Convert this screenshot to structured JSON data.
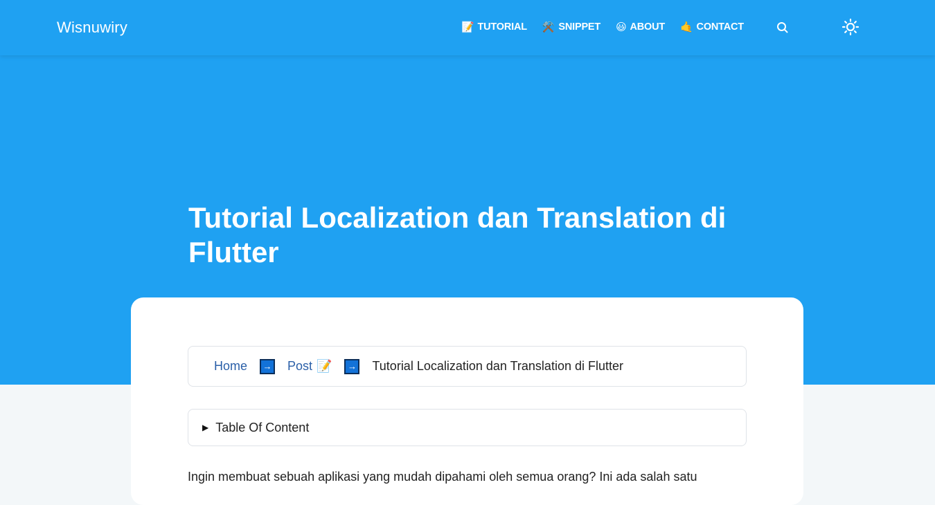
{
  "header": {
    "brand": "Wisnuwiry",
    "nav": [
      {
        "emoji": "📝",
        "label": "TUTORIAL"
      },
      {
        "emoji": "⚒️",
        "label": "SNIPPET"
      },
      {
        "emoji": "😃",
        "label": "ABOUT"
      },
      {
        "emoji": "🤙",
        "label": "CONTACT"
      }
    ],
    "search_icon": "search-icon",
    "theme_icon": "sun-icon"
  },
  "hero": {
    "title": "Tutorial Localization dan Translation di Flutter"
  },
  "breadcrumb": {
    "home": "Home",
    "separator": "→",
    "post": "Post",
    "post_emoji": "📝",
    "current": "Tutorial Localization dan Translation di Flutter"
  },
  "toc": {
    "label": "Table Of Content"
  },
  "content": {
    "intro": "Ingin membuat sebuah aplikasi yang mudah dipahami oleh semua orang? Ini ada salah satu"
  },
  "colors": {
    "primary": "#1fa1f2",
    "background": "#f3f7f9",
    "link": "#2a5fa8"
  }
}
